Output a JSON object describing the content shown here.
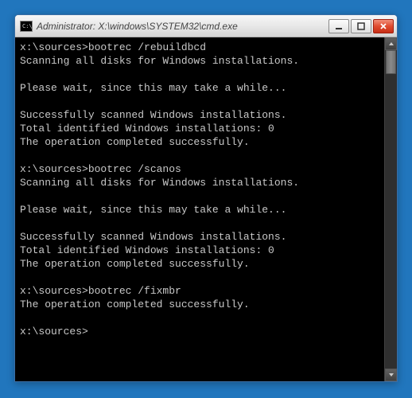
{
  "window": {
    "title": "Administrator: X:\\windows\\SYSTEM32\\cmd.exe",
    "icon_glyph": "C:\\"
  },
  "controls": {
    "minimize": "minimize",
    "maximize": "maximize",
    "close": "close"
  },
  "terminal": {
    "lines": [
      "x:\\sources>bootrec /rebuildbcd",
      "Scanning all disks for Windows installations.",
      "",
      "Please wait, since this may take a while...",
      "",
      "Successfully scanned Windows installations.",
      "Total identified Windows installations: 0",
      "The operation completed successfully.",
      "",
      "x:\\sources>bootrec /scanos",
      "Scanning all disks for Windows installations.",
      "",
      "Please wait, since this may take a while...",
      "",
      "Successfully scanned Windows installations.",
      "Total identified Windows installations: 0",
      "The operation completed successfully.",
      "",
      "x:\\sources>bootrec /fixmbr",
      "The operation completed successfully.",
      "",
      "x:\\sources>"
    ]
  }
}
